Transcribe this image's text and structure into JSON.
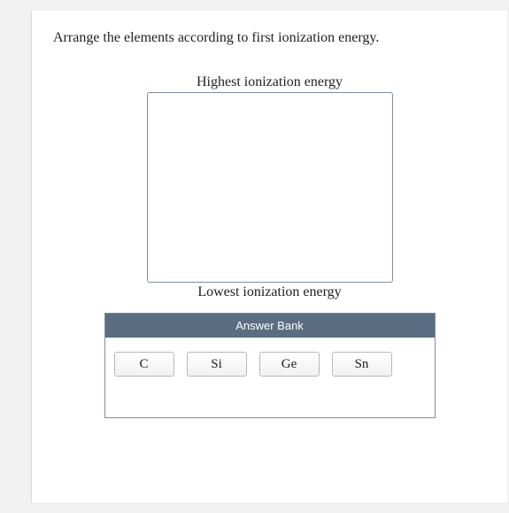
{
  "question": "Arrange the elements according to first ionization energy.",
  "ranking": {
    "top_label": "Highest ionization energy",
    "bottom_label": "Lowest ionization energy"
  },
  "answer_bank": {
    "header": "Answer Bank",
    "tiles": [
      "C",
      "Si",
      "Ge",
      "Sn"
    ]
  }
}
